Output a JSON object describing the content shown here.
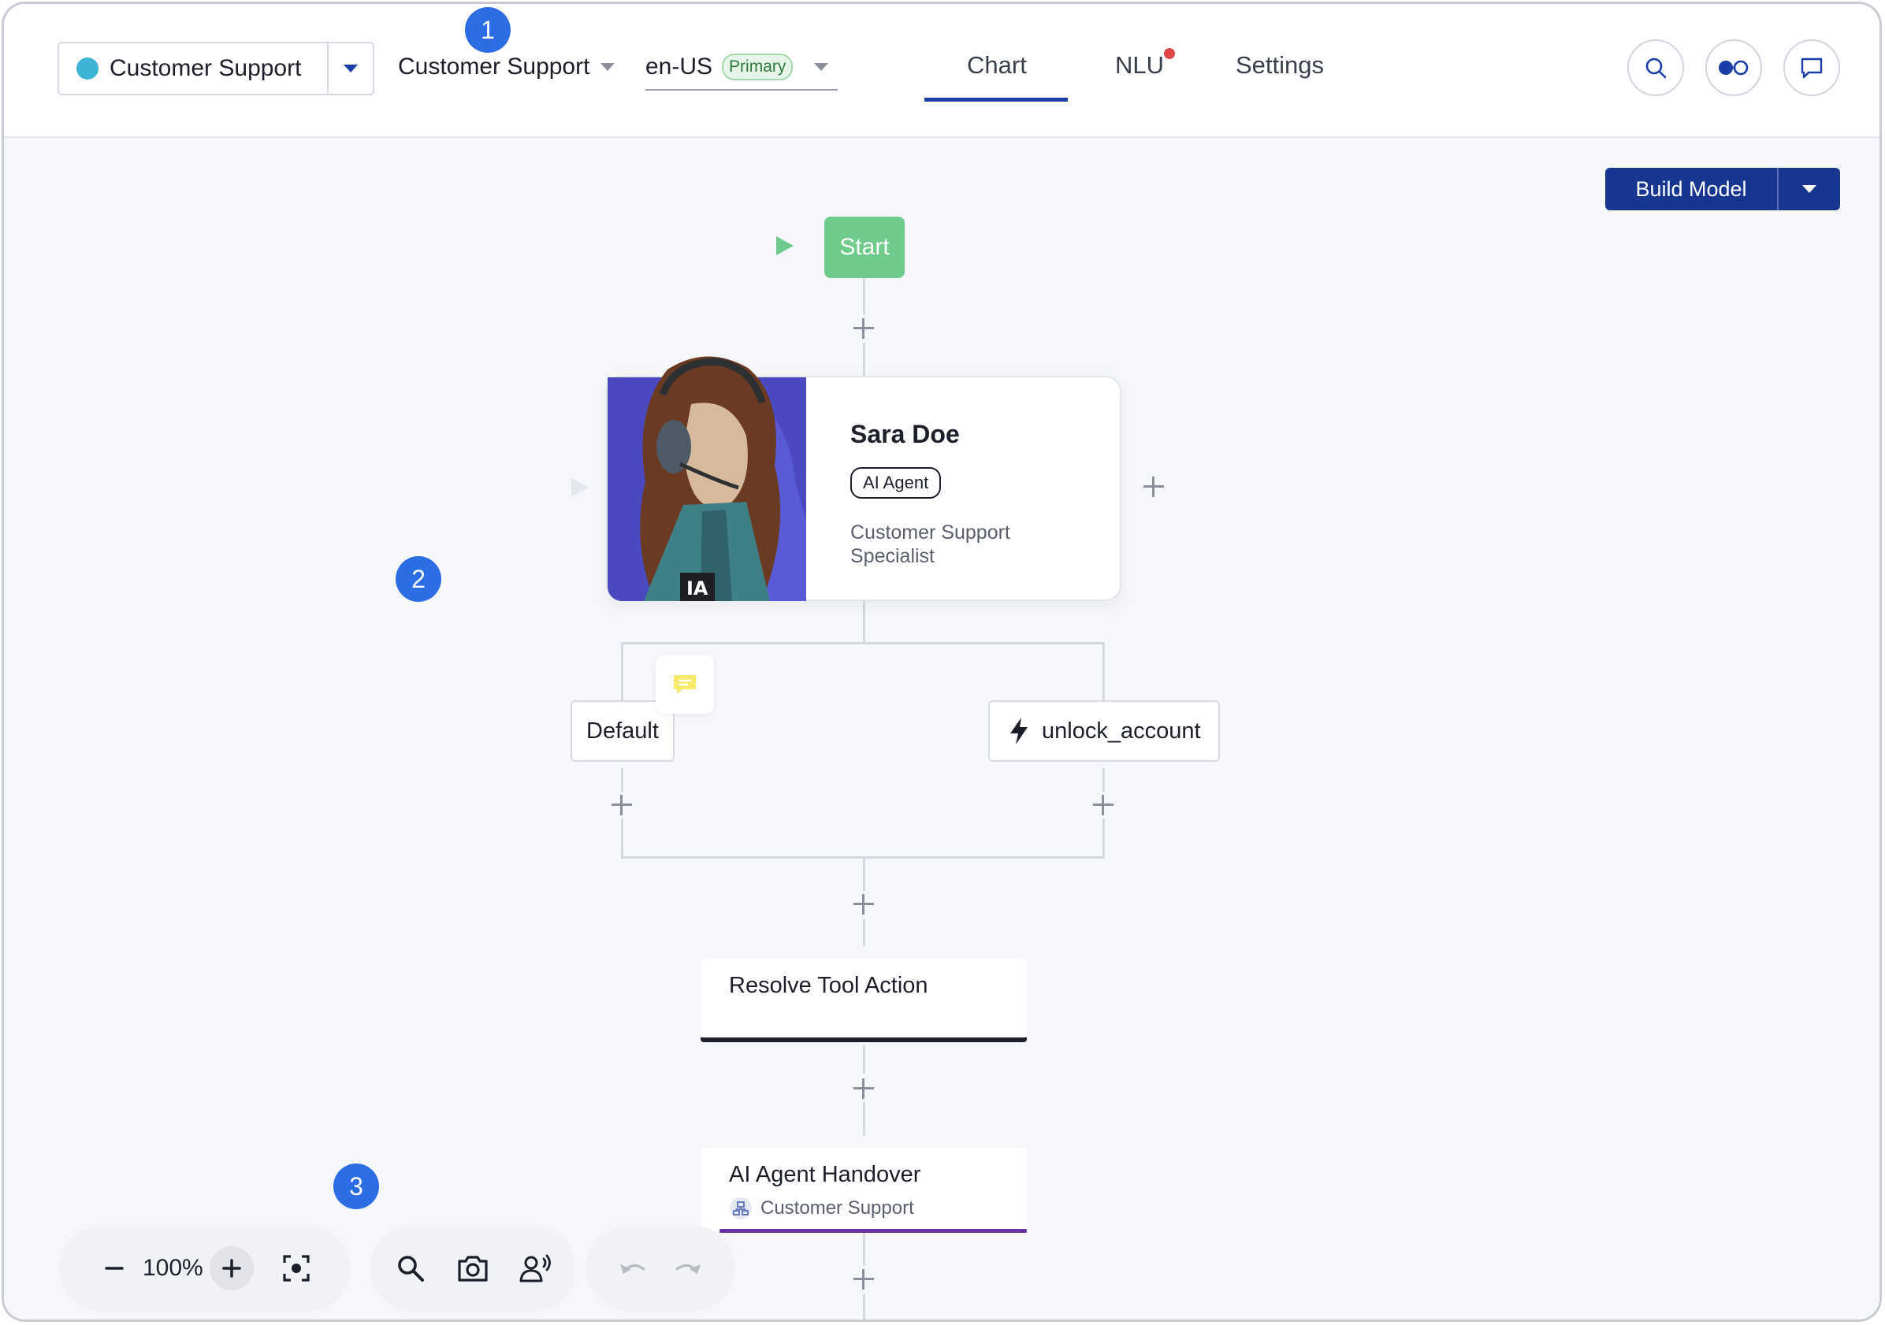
{
  "header": {
    "project": {
      "label": "Customer Support",
      "dot_color": "#3eb4d4"
    },
    "flow": {
      "label": "Customer Support"
    },
    "language": {
      "code": "en-US",
      "badge": "Primary"
    },
    "tabs": [
      {
        "label": "Chart",
        "active": true
      },
      {
        "label": "NLU",
        "has_notification": true
      },
      {
        "label": "Settings"
      }
    ],
    "actions": [
      "search-icon",
      "toggle-icon",
      "chat-icon"
    ]
  },
  "steps": {
    "one": "1",
    "two": "2",
    "three": "3"
  },
  "canvas": {
    "build_model": "Build Model",
    "start": "Start",
    "agent": {
      "name": "Sara Doe",
      "tag": "AI Agent",
      "role": "Customer Support Specialist",
      "portrait_mark": "IA"
    },
    "branches": [
      {
        "label": "Default",
        "icon": "chat-bubble-icon"
      },
      {
        "label": "unlock_account",
        "icon": "lightning-icon"
      }
    ],
    "nodes": [
      {
        "title": "Resolve Tool Action",
        "accent": "#1c1f2a"
      },
      {
        "title": "AI Agent Handover",
        "subtitle": "Customer Support",
        "accent": "#6b2fa3"
      }
    ]
  },
  "toolbar": {
    "zoom": "100%"
  },
  "colors": {
    "accent": "#1a3da8",
    "build_button": "#17368f",
    "start_node": "#6fcb8b",
    "step_badge": "#2c6ce5",
    "notification": "#e04646"
  }
}
